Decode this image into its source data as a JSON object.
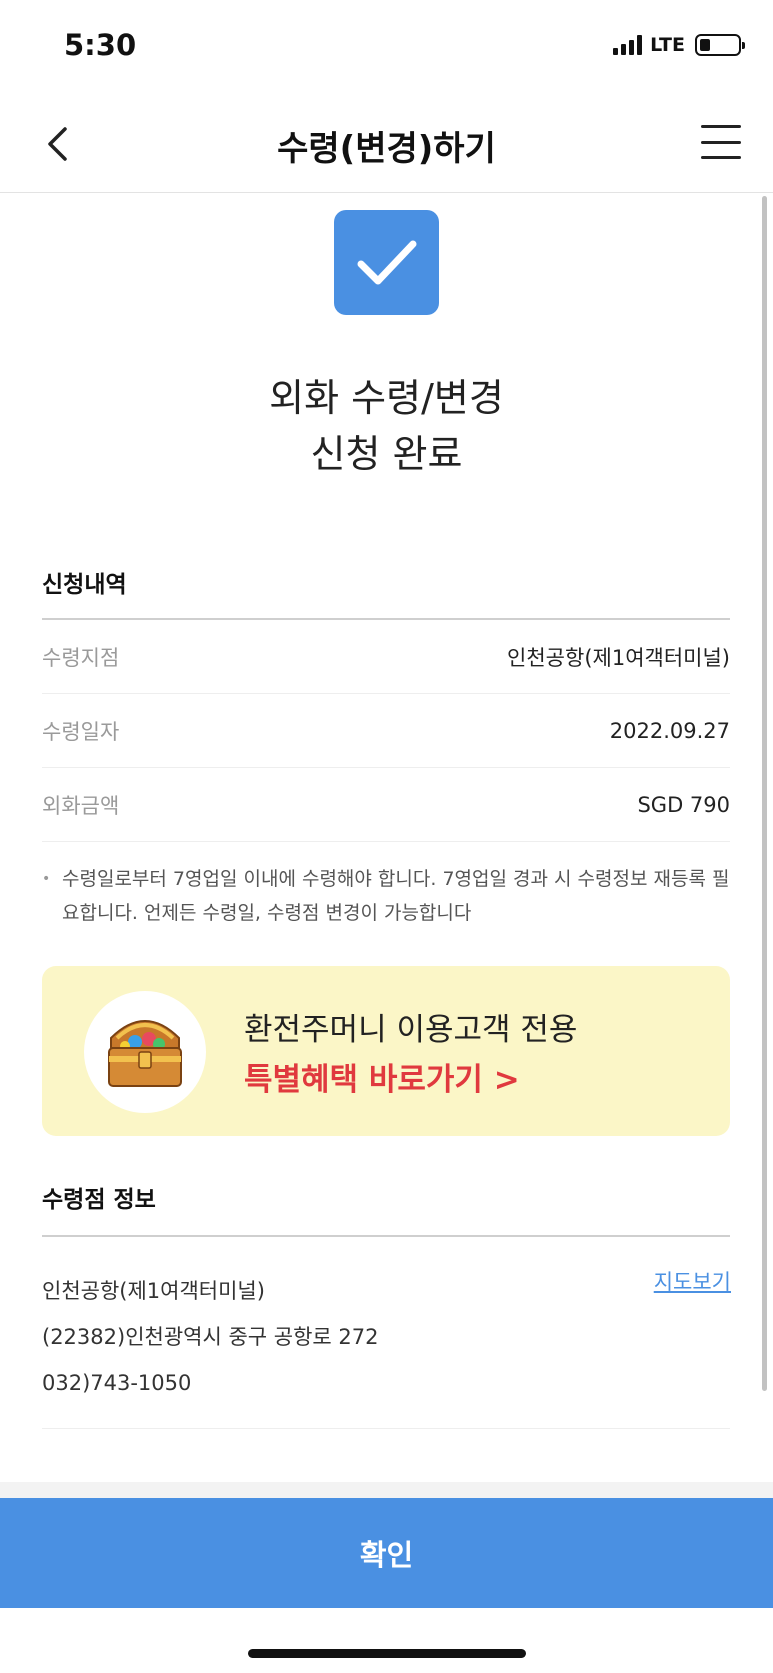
{
  "status": {
    "time": "5:30",
    "network": "LTE"
  },
  "header": {
    "title": "수령(변경)하기"
  },
  "completion": {
    "line1": "외화 수령/변경",
    "line2": "신청 완료"
  },
  "application": {
    "title": "신청내역",
    "rows": [
      {
        "label": "수령지점",
        "value": "인천공항(제1여객터미널)"
      },
      {
        "label": "수령일자",
        "value": "2022.09.27"
      },
      {
        "label": "외화금액",
        "value": "SGD 790"
      }
    ],
    "notice": "수령일로부터 7영업일 이내에 수령해야 합니다. 7영업일 경과 시 수령정보 재등록 필요합니다. 언제든 수령일, 수령점 변경이 가능합니다"
  },
  "promo": {
    "line1": "환전주머니 이용고객 전용",
    "line2": "특별혜택 바로가기 >"
  },
  "branch": {
    "title": "수령점 정보",
    "name": "인천공항(제1여객터미널)",
    "address": "(22382)인천광역시 중구 공항로 272",
    "phone": "032)743-1050",
    "map_link": "지도보기"
  },
  "footer": {
    "confirm_label": "확인"
  },
  "colors": {
    "accent": "#4a90e2",
    "promo_bg": "#fbf6c7",
    "promo_red": "#e0393e"
  },
  "icons": {
    "back": "chevron-left-icon",
    "menu": "hamburger-menu-icon",
    "check": "check-icon",
    "chest": "treasure-chest-icon"
  }
}
